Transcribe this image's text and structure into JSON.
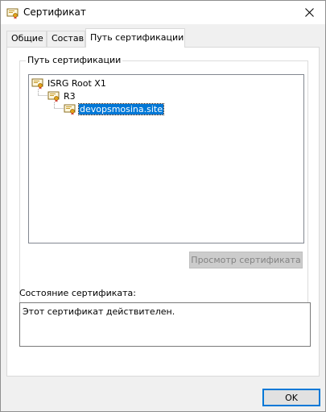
{
  "window": {
    "title": "Сертификат"
  },
  "tabs": [
    {
      "label": "Общие"
    },
    {
      "label": "Состав"
    },
    {
      "label": "Путь сертификации",
      "active": true
    }
  ],
  "cert_path": {
    "group_label": "Путь сертификации",
    "nodes": [
      {
        "label": "ISRG Root X1",
        "level": 0
      },
      {
        "label": "R3",
        "level": 1
      },
      {
        "label": "devopsmosina.site",
        "level": 2,
        "selected": true
      }
    ],
    "view_button_label": "Просмотр сертификата",
    "view_button_enabled": false
  },
  "status": {
    "label": "Состояние сертификата:",
    "text": "Этот сертификат действителен."
  },
  "footer": {
    "ok_label": "OK"
  },
  "colors": {
    "selection": "#0078d7",
    "window_bg": "#f0f0f0",
    "disabled_button": "#cccccc"
  }
}
